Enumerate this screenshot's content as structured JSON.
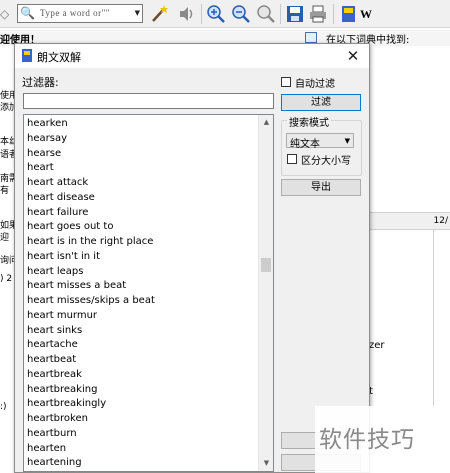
{
  "main": {
    "toolbar": {
      "search_placeholder": "Type a word or\"\"",
      "icons": [
        "back-arrow-icon",
        "search-icon",
        "dropdown-arrow-icon",
        "magic-wand-icon",
        "speaker-icon",
        "zoom-in-icon",
        "zoom-out-icon",
        "magnifier-icon",
        "save-icon",
        "print-icon",
        "dictionary-icon",
        "w-letter"
      ],
      "w_label": "W"
    },
    "welcome_text": "迎使用！",
    "lookup_label": "在以下词典中找到:",
    "left_fragments": [
      "使用",
      "添加",
      "本丝",
      "语者",
      "南需",
      "有",
      "如果",
      "迎",
      "询问",
      ") 2",
      ":)"
    ],
    "right_page": "12/",
    "right_text_zer": "zer",
    "right_text_t": "t"
  },
  "dialog": {
    "title": "朗文双解",
    "close_glyph": "✕",
    "filter_label": "过滤器:",
    "filter_value": "",
    "auto_filter_label": "自动过滤",
    "auto_filter_checked": false,
    "filter_button": "过滤",
    "search_mode_legend": "搜索模式",
    "search_mode_value": "纯文本",
    "case_sensitive_label": "区分大小写",
    "case_sensitive_checked": false,
    "export_button": "导出",
    "bottom_button_1": "",
    "bottom_button_2": "",
    "words": [
      "hearken",
      "hearsay",
      "hearse",
      "heart",
      "heart attack",
      "heart disease",
      "heart failure",
      "heart goes out to",
      "heart is in the right place",
      "heart isn't in it",
      "heart leaps",
      "heart misses a beat",
      "heart misses/skips a beat",
      "heart murmur",
      "heart sinks",
      "heartache",
      "heartbeat",
      "heartbreak",
      "heartbreaking",
      "heartbreakingly",
      "heartbroken",
      "heartburn",
      "hearten",
      "heartening"
    ],
    "scroll_position": 0.41
  },
  "watermark": "软件技巧",
  "colors": {
    "button_focus_border": "#0078d7",
    "dialog_bg": "#f0f0f0"
  }
}
